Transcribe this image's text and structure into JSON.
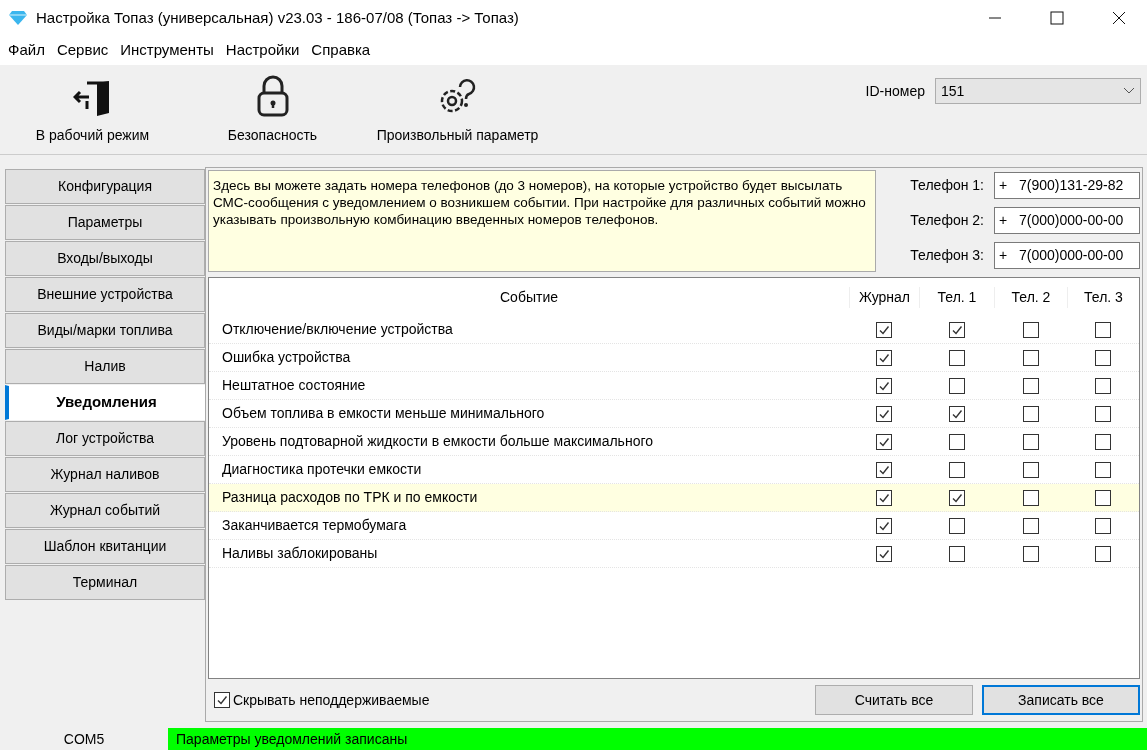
{
  "window": {
    "title": "Настройка Топаз (универсальная) v23.03 - 186-07/08 (Топаз -> Топаз)"
  },
  "menu": [
    "Файл",
    "Сервис",
    "Инструменты",
    "Настройки",
    "Справка"
  ],
  "toolbar": [
    {
      "kind": "exit",
      "label": "В рабочий режим"
    },
    {
      "kind": "lock",
      "label": "Безопасность"
    },
    {
      "kind": "gear",
      "label": "Произвольный параметр"
    }
  ],
  "id_field": {
    "label": "ID-номер",
    "value": "151"
  },
  "sidebar": [
    {
      "label": "Конфигурация",
      "selected": false
    },
    {
      "label": "Параметры",
      "selected": false
    },
    {
      "label": "Входы/выходы",
      "selected": false
    },
    {
      "label": "Внешние устройства",
      "selected": false
    },
    {
      "label": "Виды/марки топлива",
      "selected": false
    },
    {
      "label": "Налив",
      "selected": false
    },
    {
      "label": "Уведомления",
      "selected": true
    },
    {
      "label": "Лог устройства",
      "selected": false
    },
    {
      "label": "Журнал наливов",
      "selected": false
    },
    {
      "label": "Журнал событий",
      "selected": false
    },
    {
      "label": "Шаблон квитанции",
      "selected": false
    },
    {
      "label": "Терминал",
      "selected": false
    }
  ],
  "info": "Здесь вы можете задать номера телефонов (до 3 номеров), на которые устройство будет высылать СМС-сообщения с уведомлением о возникшем событии. При настройке для различных событий можно указывать произвольную комбинацию введенных номеров телефонов.",
  "phones": [
    {
      "label": "Телефон 1:",
      "prefix": "+",
      "value": "7(900)131-29-82"
    },
    {
      "label": "Телефон 2:",
      "prefix": "+",
      "value": "7(000)000-00-00"
    },
    {
      "label": "Телефон 3:",
      "prefix": "+",
      "value": "7(000)000-00-00"
    }
  ],
  "table": {
    "columns": [
      "Событие",
      "Журнал",
      "Тел. 1",
      "Тел. 2",
      "Тел. 3"
    ],
    "rows": [
      {
        "event": "Отключение/включение устройства",
        "selected": false,
        "checks": [
          true,
          true,
          false,
          false
        ]
      },
      {
        "event": "Ошибка устройства",
        "selected": false,
        "checks": [
          true,
          false,
          false,
          false
        ]
      },
      {
        "event": "Нештатное состояние",
        "selected": false,
        "checks": [
          true,
          false,
          false,
          false
        ]
      },
      {
        "event": "Объем топлива в емкости меньше минимального",
        "selected": false,
        "checks": [
          true,
          true,
          false,
          false
        ]
      },
      {
        "event": "Уровень подтоварной жидкости в емкости больше максимального",
        "selected": false,
        "checks": [
          true,
          false,
          false,
          false
        ]
      },
      {
        "event": "Диагностика протечки емкости",
        "selected": false,
        "checks": [
          true,
          false,
          false,
          false
        ]
      },
      {
        "event": "Разница расходов по ТРК и по емкости",
        "selected": true,
        "checks": [
          true,
          true,
          false,
          false
        ]
      },
      {
        "event": "Заканчивается термобумага",
        "selected": false,
        "checks": [
          true,
          false,
          false,
          false
        ]
      },
      {
        "event": "Наливы заблокированы",
        "selected": false,
        "checks": [
          true,
          false,
          false,
          false
        ]
      }
    ]
  },
  "hide_unsupported": {
    "label": "Скрывать неподдерживаемые",
    "checked": true
  },
  "buttons": [
    {
      "label": "Считать все",
      "default": false
    },
    {
      "label": "Записать все",
      "default": true
    }
  ],
  "status_bar": {
    "port": "COM5",
    "message": "Параметры уведомлений записаны"
  }
}
